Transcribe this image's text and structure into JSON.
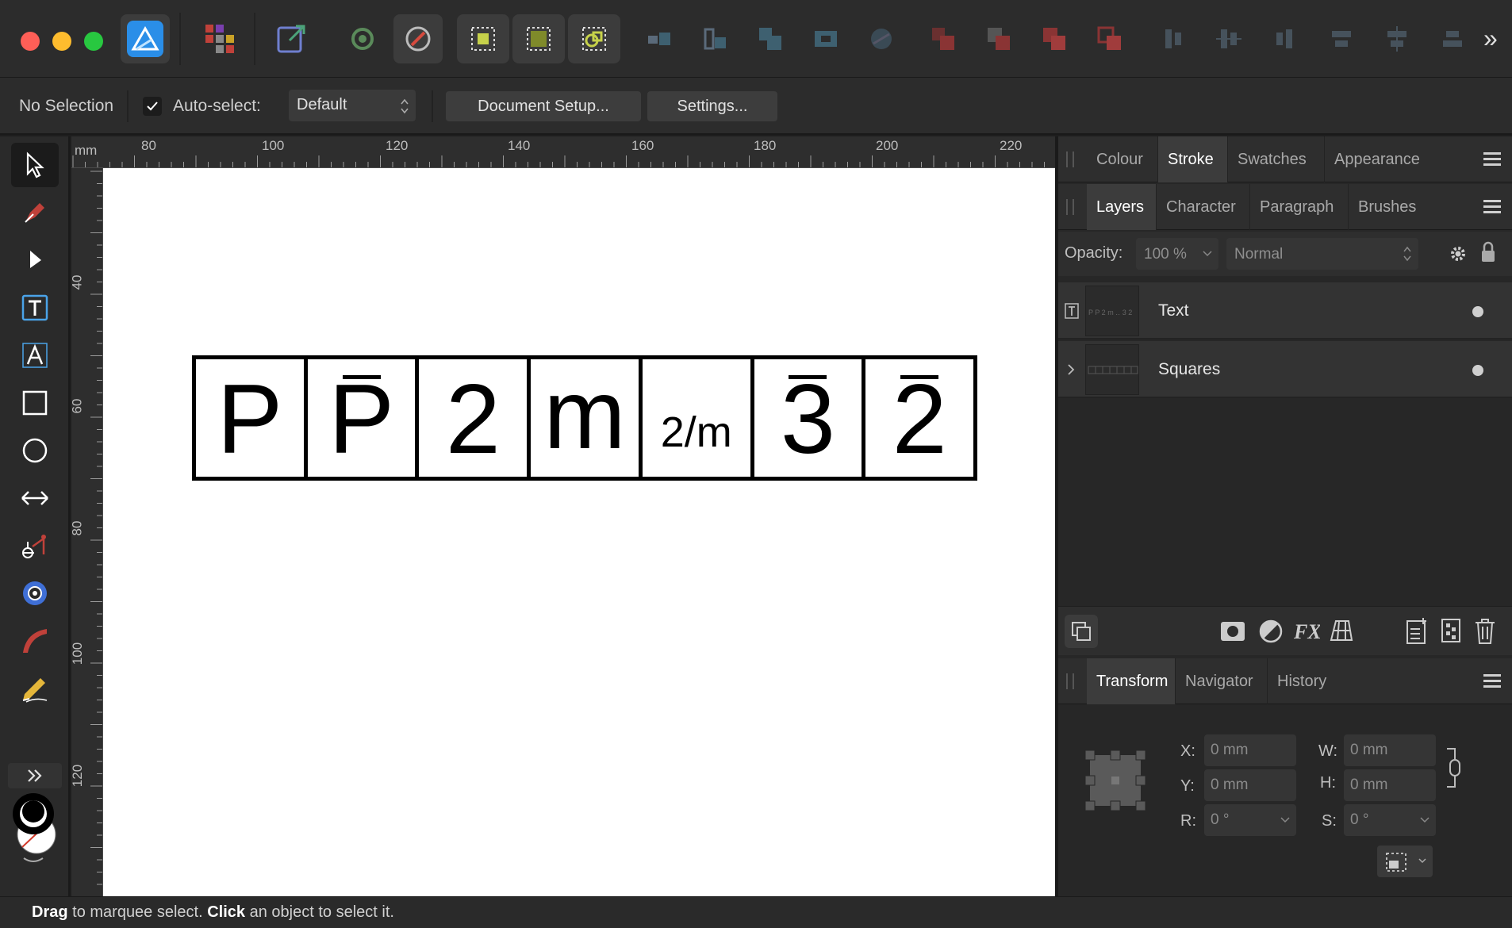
{
  "colors": {
    "close": "#fe5f57",
    "minimize": "#febc2e",
    "zoom": "#28c840",
    "app_icon": "#2a8ee8",
    "canvas": "#ffffff",
    "accent_red": "#c0413a"
  },
  "toolbar": {
    "icons": [
      "affinity-designer-icon",
      "persona-grid-icon",
      "export-persona-icon",
      "snapping-icon",
      "geometry-icon",
      "select-all-icon",
      "select-none-icon",
      "boolean-icon",
      "alignment-icons"
    ],
    "overflow_label": "»"
  },
  "context": {
    "selection_label": "No Selection",
    "autoselect_label": "Auto-select:",
    "autoselect_checked": true,
    "mode_value": "Default",
    "document_setup_label": "Document Setup...",
    "settings_label": "Settings..."
  },
  "ruler": {
    "unit": "mm",
    "h_labels": [
      "80",
      "100",
      "120",
      "140",
      "160",
      "180",
      "200",
      "220"
    ],
    "v_labels": [
      "40",
      "60",
      "80",
      "100",
      "120"
    ]
  },
  "artwork": {
    "cells": [
      {
        "text": "P",
        "bar": false,
        "small": false
      },
      {
        "text": "P",
        "bar": true,
        "small": false
      },
      {
        "text": "2",
        "bar": false,
        "small": false
      },
      {
        "text": "m",
        "bar": false,
        "small": false
      },
      {
        "text": "2/m",
        "bar": false,
        "small": true
      },
      {
        "text": "3",
        "bar": true,
        "small": false
      },
      {
        "text": "2",
        "bar": true,
        "small": false
      }
    ]
  },
  "panels": {
    "top_tabs": [
      "Colour",
      "Stroke",
      "Swatches",
      "Appearance"
    ],
    "top_active": "Stroke",
    "layer_tabs": [
      "Layers",
      "Character",
      "Paragraph",
      "Brushes"
    ],
    "layer_active": "Layers",
    "opacity_label": "Opacity:",
    "opacity_value": "100 %",
    "blend_mode": "Normal",
    "layers": [
      {
        "name": "Text",
        "type_icon": "text-layer-icon"
      },
      {
        "name": "Squares",
        "type_icon": "expand-chevron-icon"
      }
    ],
    "bottom_tabs": [
      "Transform",
      "Navigator",
      "History"
    ],
    "bottom_active": "Transform",
    "transform": {
      "x_label": "X:",
      "x_value": "0 mm",
      "y_label": "Y:",
      "y_value": "0 mm",
      "w_label": "W:",
      "w_value": "0 mm",
      "h_label": "H:",
      "h_value": "0 mm",
      "r_label": "R:",
      "r_value": "0 °",
      "s_label": "S:",
      "s_value": "0 °"
    }
  },
  "status": {
    "drag": "Drag",
    "drag_text": " to marquee select. ",
    "click": "Click",
    "click_text": " an object to select it."
  }
}
